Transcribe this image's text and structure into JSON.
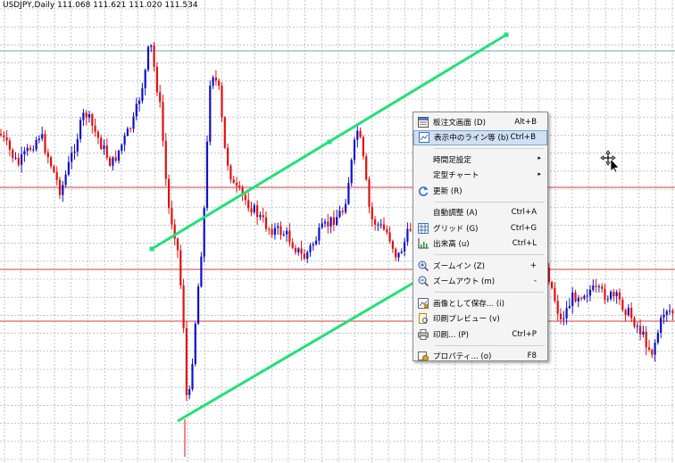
{
  "chart": {
    "symbol_info": "USDJPY,Daily  111.068 111.621 111.020 111.534",
    "colors": {
      "background": "#ffffff",
      "grid": "#9aa0a6",
      "bull_candle": "#1010c8",
      "bear_candle": "#e01010",
      "trendline": "#22e07a",
      "horizontal_lines": "#d24040",
      "top_line": "#6fa8a8"
    }
  },
  "context_menu": {
    "items": [
      {
        "icon": "order-book-icon",
        "label": "板注文画面 (D)",
        "shortcut": "Alt+B"
      },
      {
        "icon": "line-list-icon",
        "label": "表示中のライン等 (b)",
        "shortcut": "Ctrl+B",
        "highlighted": true
      },
      {
        "separator": true
      },
      {
        "icon": "",
        "label": "時間足設定",
        "shortcut": "",
        "submenu": true
      },
      {
        "icon": "",
        "label": "定型チャート",
        "shortcut": "",
        "submenu": true
      },
      {
        "icon": "refresh-icon",
        "label": "更新 (R)",
        "shortcut": ""
      },
      {
        "separator": true
      },
      {
        "icon": "",
        "label": "自動調整 (A)",
        "shortcut": "Ctrl+A"
      },
      {
        "icon": "grid-icon",
        "label": "グリッド (G)",
        "shortcut": "Ctrl+G"
      },
      {
        "icon": "volume-icon",
        "label": "出来高 (u)",
        "shortcut": "Ctrl+L"
      },
      {
        "separator": true
      },
      {
        "icon": "zoom-in-icon",
        "label": "ズームイン (Z)",
        "shortcut": "+"
      },
      {
        "icon": "zoom-out-icon",
        "label": "ズームアウト (m)",
        "shortcut": "-"
      },
      {
        "separator": true
      },
      {
        "icon": "save-image-icon",
        "label": "画像として保存... (i)",
        "shortcut": ""
      },
      {
        "icon": "print-preview-icon",
        "label": "印刷プレビュー (v)",
        "shortcut": ""
      },
      {
        "icon": "print-icon",
        "label": "印刷... (P)",
        "shortcut": "Ctrl+P"
      },
      {
        "separator": true
      },
      {
        "icon": "properties-icon",
        "label": "プロパティ... (o)",
        "shortcut": "F8"
      }
    ]
  }
}
